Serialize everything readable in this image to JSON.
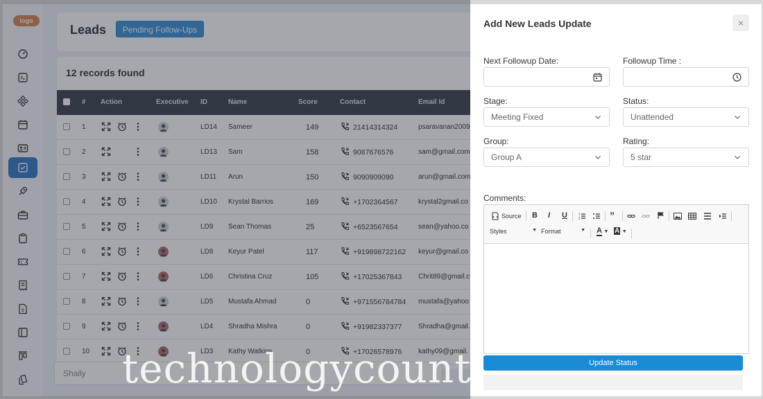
{
  "sidebar": {
    "logo": "logo",
    "items": [
      {
        "icon": "dashboard-icon"
      },
      {
        "icon": "terminal-icon"
      },
      {
        "icon": "modules-icon"
      },
      {
        "icon": "calendar-icon"
      },
      {
        "icon": "contact-card-icon"
      },
      {
        "icon": "checklist-icon",
        "active": true
      },
      {
        "icon": "rocket-icon"
      },
      {
        "icon": "briefcase-icon"
      },
      {
        "icon": "clipboard-icon"
      },
      {
        "icon": "ticket-icon"
      },
      {
        "icon": "receipt-icon"
      },
      {
        "icon": "invoice-icon"
      },
      {
        "icon": "layout-icon"
      },
      {
        "icon": "kanban-icon"
      },
      {
        "icon": "files-icon"
      }
    ]
  },
  "header": {
    "title": "Leads",
    "pending_button": "Pending Follow-Ups"
  },
  "table": {
    "records_found": "12 records found",
    "columns": [
      "#",
      "Action",
      "Executive",
      "ID",
      "Name",
      "Score",
      "Contact",
      "Email Id"
    ],
    "rows": [
      {
        "n": "1",
        "id": "LD14",
        "name": "Sameer",
        "score": "149",
        "contact": "21414314324",
        "email": "psaravanan2009",
        "alarm": true,
        "female": false
      },
      {
        "n": "2",
        "id": "LD13",
        "name": "Sam",
        "score": "158",
        "contact": "9087676576",
        "email": "sam@gmail.com",
        "alarm": false,
        "female": false
      },
      {
        "n": "3",
        "id": "LD11",
        "name": "Arun",
        "score": "150",
        "contact": "9090909090",
        "email": "arun@gmail.com",
        "alarm": true,
        "female": false
      },
      {
        "n": "4",
        "id": "LD10",
        "name": "Krystal Barrios",
        "score": "169",
        "contact": "+1702364567",
        "email": "krystal2gmail.co",
        "alarm": true,
        "female": false
      },
      {
        "n": "5",
        "id": "LD9",
        "name": "Sean Thomas",
        "score": "25",
        "contact": "+6523567654",
        "email": "sean@yahoo.co",
        "alarm": true,
        "female": false
      },
      {
        "n": "6",
        "id": "LD8",
        "name": "Keyur Patel",
        "score": "117",
        "contact": "+919898722162",
        "email": "keyur@gmail.co",
        "alarm": true,
        "female": true
      },
      {
        "n": "7",
        "id": "LD6",
        "name": "Christina Cruz",
        "score": "105",
        "contact": "+17025367843",
        "email": "Chrit89@gmail.c",
        "alarm": true,
        "female": true
      },
      {
        "n": "8",
        "id": "LD5",
        "name": "Mustafa Ahmad",
        "score": "0",
        "contact": "+971556784784",
        "email": "mustafa@yahoo",
        "alarm": true,
        "female": false
      },
      {
        "n": "9",
        "id": "LD4",
        "name": "Shradha Mishra",
        "score": "0",
        "contact": "+91982337377",
        "email": "Shradha@gmail.",
        "alarm": true,
        "female": true
      },
      {
        "n": "10",
        "id": "LD3",
        "name": "Kathy Watkins",
        "score": "0",
        "contact": "+17026578976",
        "email": "kathy09@gmail.",
        "alarm": true,
        "female": true
      }
    ]
  },
  "footer": {
    "executive_filter": "Shaily"
  },
  "drawer": {
    "title": "Add New Leads Update",
    "close": "×",
    "next_followup_date_label": "Next Followup Date:",
    "next_followup_date_value": "",
    "followup_time_label": "Followup Time :",
    "followup_time_value": "",
    "stage_label": "Stage:",
    "stage_value": "Meeting Fixed",
    "status_label": "Status:",
    "status_value": "Unattended",
    "group_label": "Group:",
    "group_value": "Group A",
    "rating_label": "Rating:",
    "rating_value": "5 star",
    "comments_label": "Comments:",
    "toolbar": {
      "source": "Source",
      "styles": "Styles",
      "format": "Format"
    },
    "update_button": "Update Status"
  },
  "watermark": "technologycounter.com"
}
